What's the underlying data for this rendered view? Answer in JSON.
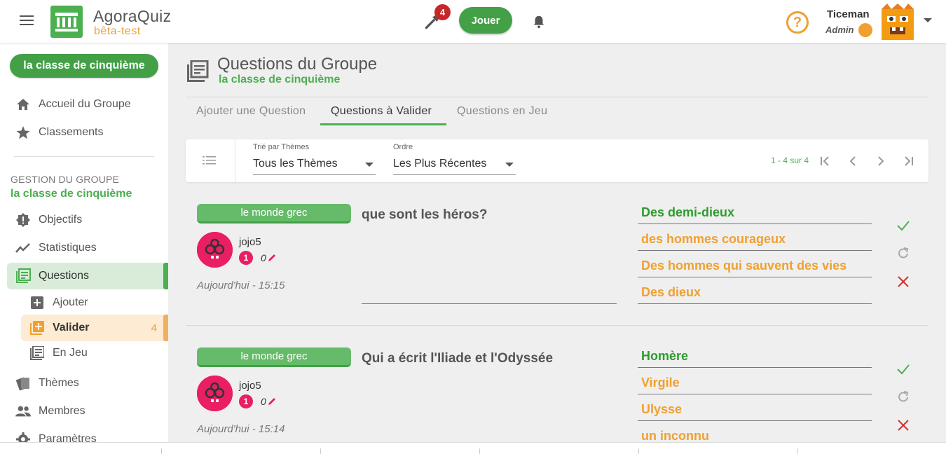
{
  "app": {
    "name": "AgoraQuiz",
    "subtitle": "bêta-test",
    "notif_count": "4",
    "play_label": "Jouer",
    "user_name": "Ticeman",
    "user_role": "Admin",
    "accent_green": "#43a047",
    "accent_orange": "#f0a030"
  },
  "sidebar": {
    "group_button": "la classe de cinquième",
    "items": [
      {
        "label": "Accueil du Groupe",
        "icon": "home-icon"
      },
      {
        "label": "Classements",
        "icon": "star-icon"
      }
    ],
    "section_title": "GESTION DU GROUPE",
    "section_sub": "la classe de cinquième",
    "mgmt_items": [
      {
        "label": "Objectifs",
        "icon": "badge-icon"
      },
      {
        "label": "Statistiques",
        "icon": "chart-line-icon"
      },
      {
        "label": "Questions",
        "icon": "questions-icon"
      }
    ],
    "sub_items": [
      {
        "label": "Ajouter",
        "icon": "plus-box-icon"
      },
      {
        "label": "Valider",
        "icon": "library-add-icon",
        "count": "4"
      },
      {
        "label": "En Jeu",
        "icon": "library-icon"
      }
    ],
    "bottom_items": [
      {
        "label": "Thèmes",
        "icon": "cards-icon"
      },
      {
        "label": "Membres",
        "icon": "people-icon"
      },
      {
        "label": "Paramètres",
        "icon": "gear-icon"
      }
    ]
  },
  "main": {
    "title": "Questions du Groupe",
    "subtitle": "la classe de cinquième",
    "tabs": [
      {
        "label": "Ajouter une Question"
      },
      {
        "label": "Questions à Valider"
      },
      {
        "label": "Questions en Jeu"
      }
    ],
    "filters": {
      "sort_label": "Trié par Thèmes",
      "sort_value": "Tous les Thèmes",
      "order_label": "Ordre",
      "order_value": "Les Plus Récentes",
      "page_info": "1 - 4 sur 4"
    },
    "questions": [
      {
        "theme": "le monde grec",
        "author": "jojo5",
        "level": "1",
        "count": "0",
        "date": "Aujourd'hui - 15:15",
        "text": "que sont les héros?",
        "answers": [
          "Des demi-dieux",
          "des hommes courageux",
          "Des hommes qui sauvent des vies",
          "Des dieux"
        ]
      },
      {
        "theme": "le monde grec",
        "author": "jojo5",
        "level": "1",
        "count": "0",
        "date": "Aujourd'hui - 15:14",
        "text": "Qui a écrit l'Iliade et l'Odyssée",
        "answers": [
          "Homère",
          "Virgile",
          "Ulysse",
          "un inconnu"
        ]
      }
    ]
  }
}
